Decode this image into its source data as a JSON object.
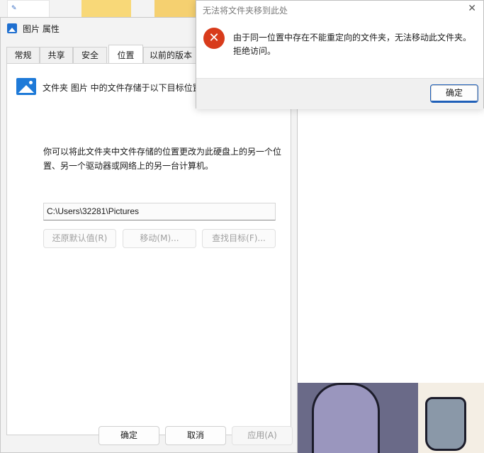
{
  "properties_dialog": {
    "title": "图片 属性",
    "tabs": [
      {
        "label": "常规"
      },
      {
        "label": "共享"
      },
      {
        "label": "安全"
      },
      {
        "label": "位置"
      },
      {
        "label": "以前的版本"
      }
    ],
    "active_tab": "位置",
    "heading": "文件夹 图片 中的文件存储于以下目标位置",
    "description": "你可以将此文件夹中文件存储的位置更改为此硬盘上的另一个位置、另一个驱动器或网络上的另一台计算机。",
    "path_value": "C:\\Users\\32281\\Pictures",
    "buttons": {
      "restore_default": "还原默认值(R)",
      "move": "移动(M)...",
      "find_target": "查找目标(F)..."
    },
    "footer": {
      "ok": "确定",
      "cancel": "取消",
      "apply": "应用(A)"
    }
  },
  "error_dialog": {
    "title": "无法将文件夹移到此处",
    "close_glyph": "✕",
    "icon_glyph": "✕",
    "message": "由于同一位置中存在不能重定向的文件夹，无法移动此文件夹。拒绝访问。",
    "ok_label": "确定"
  },
  "colors": {
    "accent": "#1f5fb8",
    "error": "#d83b1b",
    "folder_icon": "#1e7ad8"
  }
}
